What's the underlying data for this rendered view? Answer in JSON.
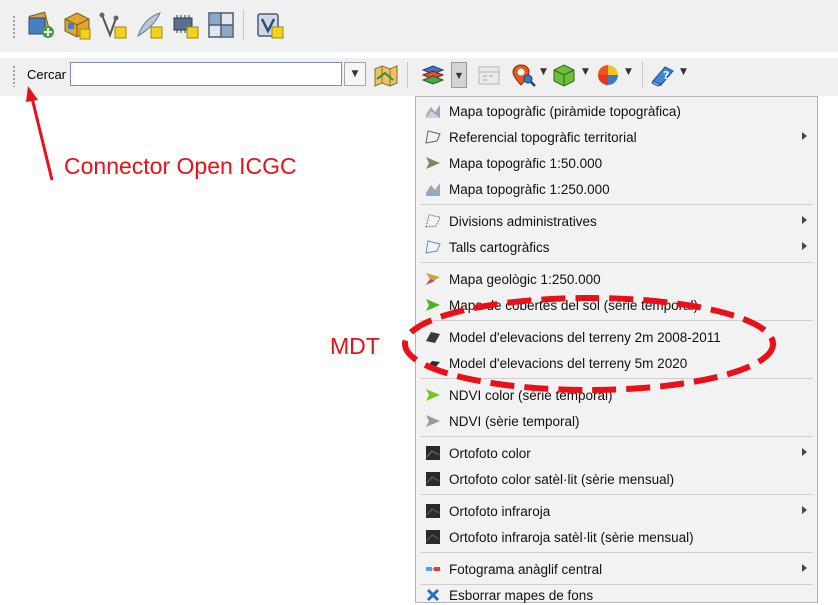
{
  "colors": {
    "annotation": "#e8111a",
    "toolbar_bg": "#f0f0f0",
    "menu_bg": "#f2f2f2"
  },
  "toolbar_top": {
    "icons": [
      "add-raster-layer-icon",
      "add-3d-layer-icon",
      "add-vector-layer-icon",
      "digitize-feather-icon",
      "add-chip-layer-icon",
      "add-grid-layer-icon",
      "virtual-layer-icon"
    ]
  },
  "search": {
    "label": "Cercar",
    "value": ""
  },
  "toolbar_icons": [
    "map-icon",
    "background-maps-icon",
    "time-icon",
    "geofinder-icon",
    "3d-box-icon",
    "color-pie-icon",
    "help-icon"
  ],
  "menu": {
    "items": [
      {
        "label": "Mapa topogràfic (piràmide topogràfica)",
        "icon": "topo-map-icon",
        "submenu": false
      },
      {
        "label": "Referencial topogràfic territorial",
        "icon": "topo-referential-icon",
        "submenu": true
      },
      {
        "label": "Mapa topogràfic 1:50.000",
        "icon": "topo-map-50k-icon",
        "submenu": false
      },
      {
        "label": "Mapa topogràfic 1:250.000",
        "icon": "topo-map-250k-icon",
        "submenu": false
      },
      {
        "label": "Divisions administratives",
        "icon": "admin-divisions-icon",
        "submenu": true
      },
      {
        "label": "Talls cartogràfics",
        "icon": "cartographic-cuts-icon",
        "submenu": true
      },
      {
        "label": "Mapa geològic 1:250.000",
        "icon": "geological-map-icon",
        "submenu": false
      },
      {
        "label": "Mapa de cobertes del sòl (sèrie temporal)",
        "icon": "land-cover-icon",
        "submenu": false
      },
      {
        "label": "Model d'elevacions del terreny 2m 2008-2011",
        "icon": "elevation-model-icon",
        "submenu": false
      },
      {
        "label": "Model d'elevacions del terreny 5m 2020",
        "icon": "elevation-model-icon",
        "submenu": false
      },
      {
        "label": "NDVI color (sèrie temporal)",
        "icon": "ndvi-color-icon",
        "submenu": false
      },
      {
        "label": "NDVI (sèrie temporal)",
        "icon": "ndvi-icon",
        "submenu": false
      },
      {
        "label": "Ortofoto color",
        "icon": "orthophoto-icon",
        "submenu": true
      },
      {
        "label": "Ortofoto color satèl·lit (sèrie mensual)",
        "icon": "orthophoto-satellite-icon",
        "submenu": false
      },
      {
        "label": "Ortofoto infraroja",
        "icon": "orthophoto-infrared-icon",
        "submenu": true
      },
      {
        "label": "Ortofoto infraroja satèl·lit (sèrie mensual)",
        "icon": "orthophoto-infrared-satellite-icon",
        "submenu": false
      },
      {
        "label": "Fotograma anàglif central",
        "icon": "anaglyph-icon",
        "submenu": true
      },
      {
        "label": "Esborrar mapes de fons",
        "icon": "clear-icon",
        "submenu": false
      }
    ]
  },
  "annotations": {
    "connector": "Connector Open ICGC",
    "mdt": "MDT"
  }
}
